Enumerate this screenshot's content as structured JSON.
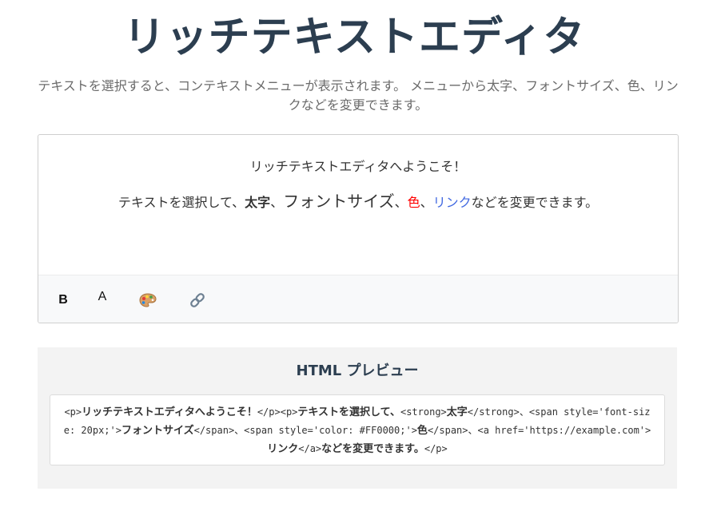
{
  "header": {
    "title": "リッチテキストエディタ",
    "subtitle": "テキストを選択すると、コンテキストメニューが表示されます。 メニューから太字、フォントサイズ、色、リンクなどを変更できます。"
  },
  "editor": {
    "line1": "リッチテキストエディタへようこそ！",
    "line2": {
      "prefix": "テキストを選択して、",
      "bold": "太字",
      "sep1": "、",
      "font_size": "フォントサイズ",
      "sep2": "、",
      "color": "色",
      "sep3": "、",
      "link": "リンク",
      "suffix": "などを変更できます。"
    },
    "colors": {
      "red": "#FF0000",
      "link": "#4169E1"
    }
  },
  "toolbar": {
    "bold_label": "B",
    "font_size_label": "A",
    "color_icon": "palette-icon",
    "link_icon": "link-icon"
  },
  "preview": {
    "title": "HTML プレビュー",
    "html_parts": [
      "<p>",
      "リッチテキストエディタへようこそ！",
      "</p><p>",
      "テキストを選択して、",
      "<strong>",
      "太字",
      "</strong>、<span style='font-size: 20px;'>",
      "フォントサイズ",
      "</span>、<span style='color: #FF0000;'>",
      "色",
      "</span>、<a href='https://example.com'>",
      "リンク",
      "</a>",
      "などを変更できます。",
      "</p>"
    ]
  }
}
